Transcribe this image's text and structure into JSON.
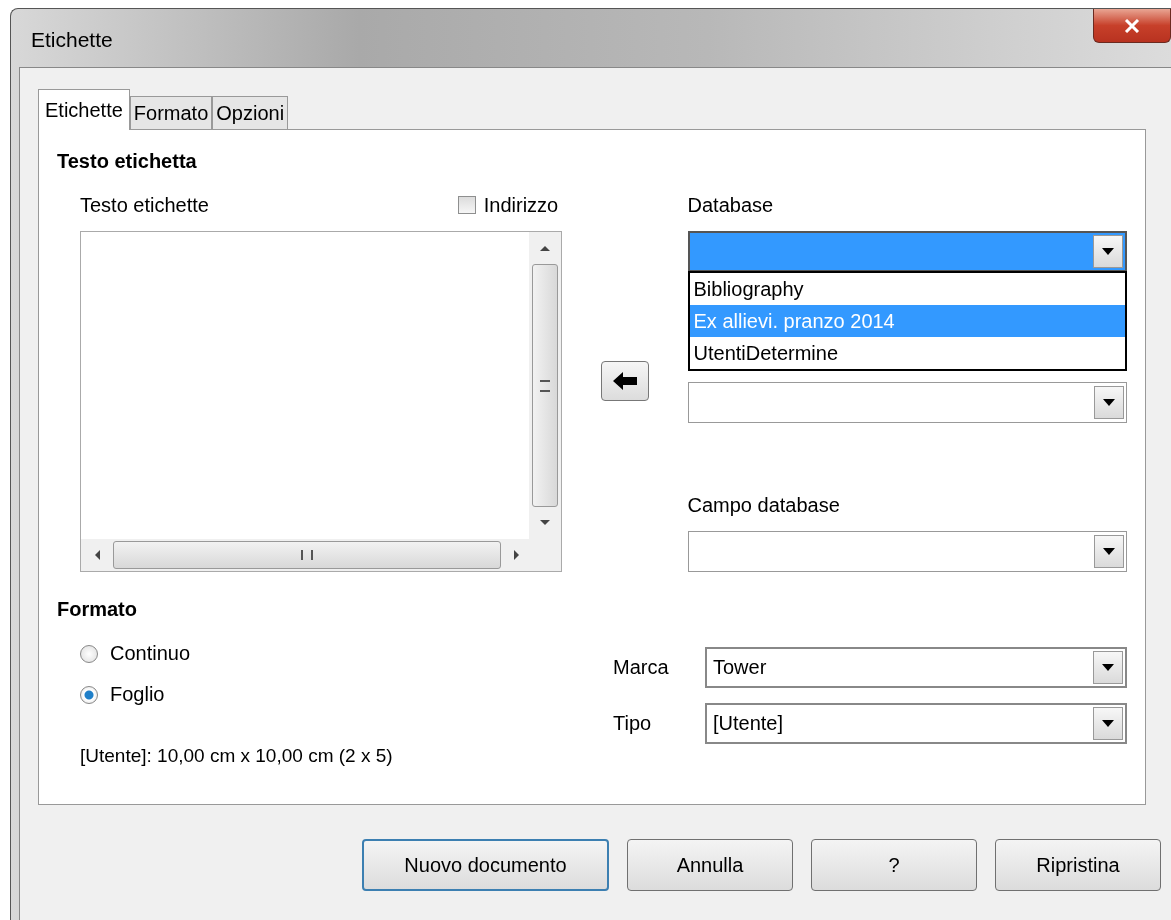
{
  "window": {
    "title": "Etichette"
  },
  "tabs": [
    {
      "label": "Etichette",
      "selected": true
    },
    {
      "label": "Formato",
      "selected": false
    },
    {
      "label": "Opzioni",
      "selected": false
    }
  ],
  "label_text": {
    "heading": "Testo etichetta",
    "field_label": "Testo etichette",
    "address_checkbox": {
      "label": "Indirizzo",
      "checked": false
    }
  },
  "database": {
    "label": "Database",
    "focused": true,
    "open": true,
    "options": [
      {
        "label": "Bibliography",
        "selected": false
      },
      {
        "label": "Ex allievi. pranzo 2014",
        "selected": true
      },
      {
        "label": "UtentiDetermine",
        "selected": false
      }
    ]
  },
  "database_field": {
    "label": "Campo database"
  },
  "format": {
    "heading": "Formato",
    "options": [
      {
        "label": "Continuo",
        "selected": false
      },
      {
        "label": "Foglio",
        "selected": true
      }
    ],
    "summary": "[Utente]: 10,00 cm x 10,00 cm (2 x 5)"
  },
  "brand": {
    "label": "Marca",
    "value": "Tower"
  },
  "type": {
    "label": "Tipo",
    "value": "[Utente]"
  },
  "buttons": [
    {
      "label": "Nuovo documento",
      "default": true
    },
    {
      "label": "Annulla",
      "default": false
    },
    {
      "label": "?",
      "default": false
    },
    {
      "label": "Ripristina",
      "default": false
    }
  ]
}
